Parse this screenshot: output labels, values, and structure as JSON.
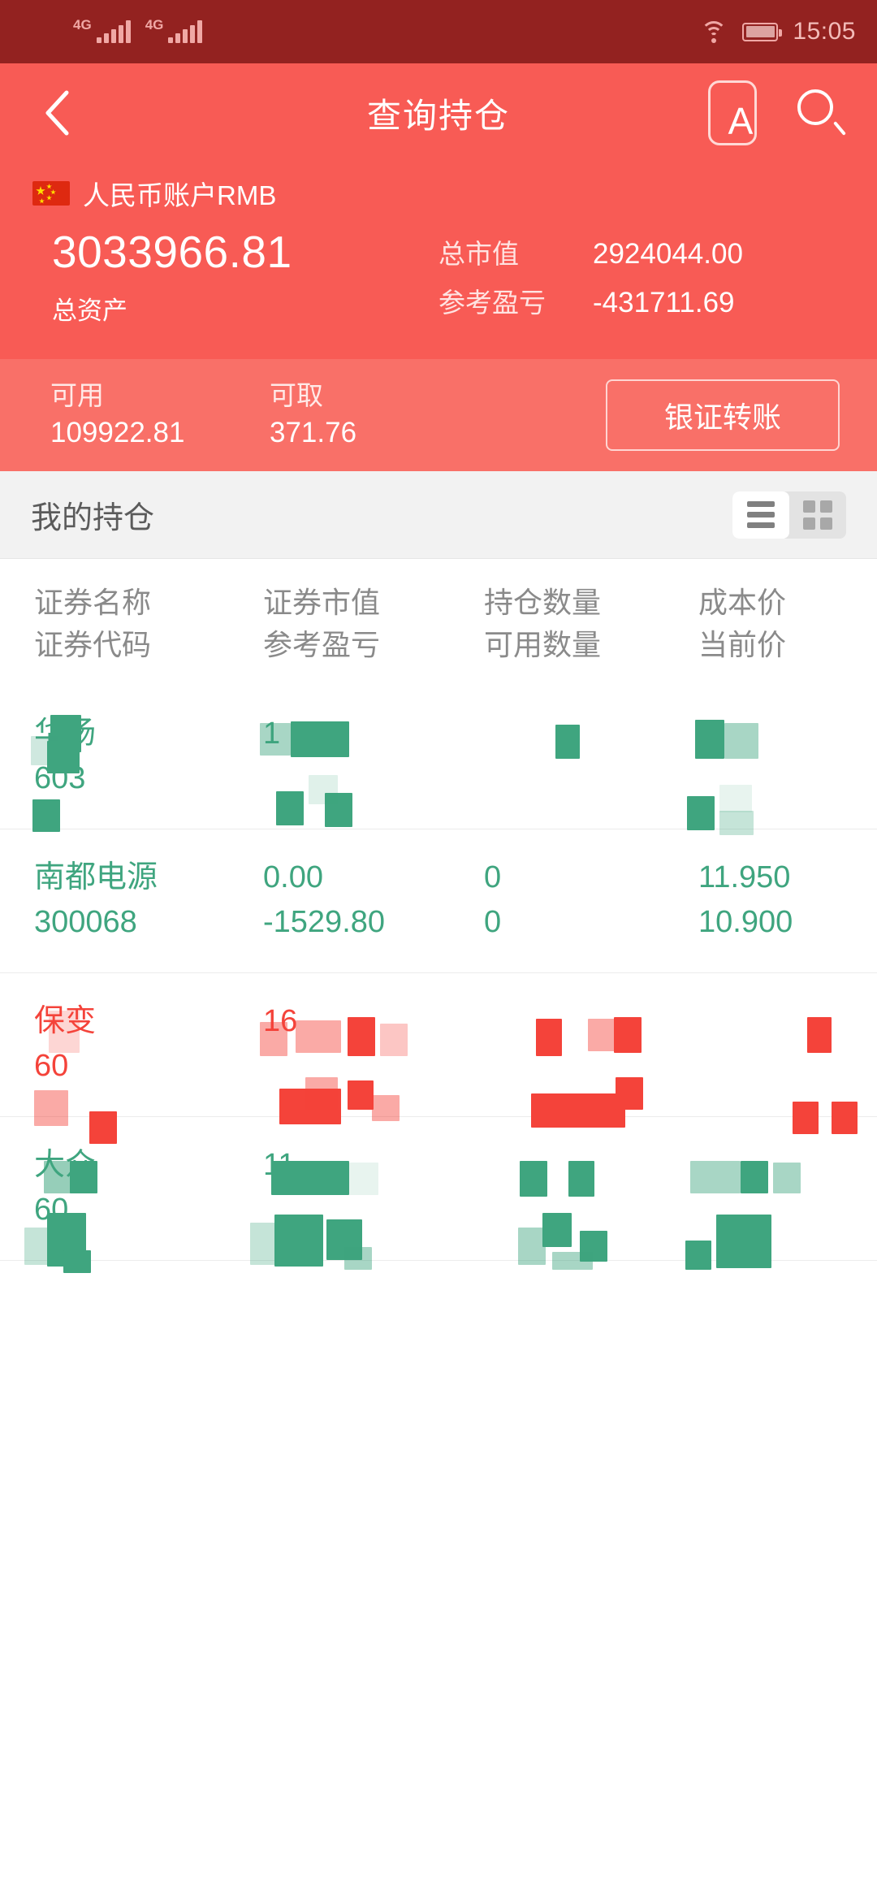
{
  "status_bar": {
    "network_1": "4G",
    "network_2": "4G",
    "wifi_icon": "wifi-icon",
    "battery_icon": "battery-icon",
    "time": "15:05"
  },
  "nav": {
    "back_icon": "back-chevron-icon",
    "title": "查询持仓",
    "font_size_icon_label": "A",
    "search_icon": "search-icon"
  },
  "account": {
    "flag_icon": "china-flag-icon",
    "name": "人民币账户RMB",
    "total_assets_value": "3033966.81",
    "total_assets_label": "总资产",
    "market_value_label": "总市值",
    "market_value": "2924044.00",
    "profit_loss_label": "参考盈亏",
    "profit_loss": "-431711.69"
  },
  "available": {
    "usable_label": "可用",
    "usable_value": "109922.81",
    "withdrawable_label": "可取",
    "withdrawable_value": "371.76",
    "transfer_button": "银证转账"
  },
  "holdings_bar": {
    "title": "我的持仓",
    "list_view_icon": "list-view-icon",
    "grid_view_icon": "grid-view-icon",
    "active_view": "list"
  },
  "table": {
    "headers": [
      {
        "top": "证券名称",
        "bottom": "证券代码"
      },
      {
        "top": "证券市值",
        "bottom": "参考盈亏"
      },
      {
        "top": "持仓数量",
        "bottom": "可用数量"
      },
      {
        "top": "成本价",
        "bottom": "当前价"
      }
    ],
    "rows": [
      {
        "redacted": true,
        "color": "green",
        "name": "华扬",
        "code": "603",
        "market_value": "1",
        "profit_loss": "",
        "quantity": "",
        "available_qty": "",
        "cost_price": "",
        "current_price": ""
      },
      {
        "redacted": false,
        "color": "green",
        "name": "南都电源",
        "code": "300068",
        "market_value": "0.00",
        "profit_loss": "-1529.80",
        "quantity": "0",
        "available_qty": "0",
        "cost_price": "11.950",
        "current_price": "10.900"
      },
      {
        "redacted": true,
        "color": "red",
        "name": "保变",
        "code": "60",
        "market_value": "16",
        "profit_loss": "",
        "quantity": "",
        "available_qty": "",
        "cost_price": "",
        "current_price": ""
      },
      {
        "redacted": true,
        "color": "green",
        "name": "大众",
        "code": "60",
        "market_value": "11、",
        "profit_loss": "",
        "quantity": "",
        "available_qty": "",
        "cost_price": "",
        "current_price": ""
      }
    ]
  },
  "colors": {
    "status_bar": "#932220",
    "header": "#F85B55",
    "header_light": "#F97068",
    "gain_green": "#3FA57F",
    "loss_red": "#F4433A",
    "section_bg": "#F2F2F2"
  }
}
